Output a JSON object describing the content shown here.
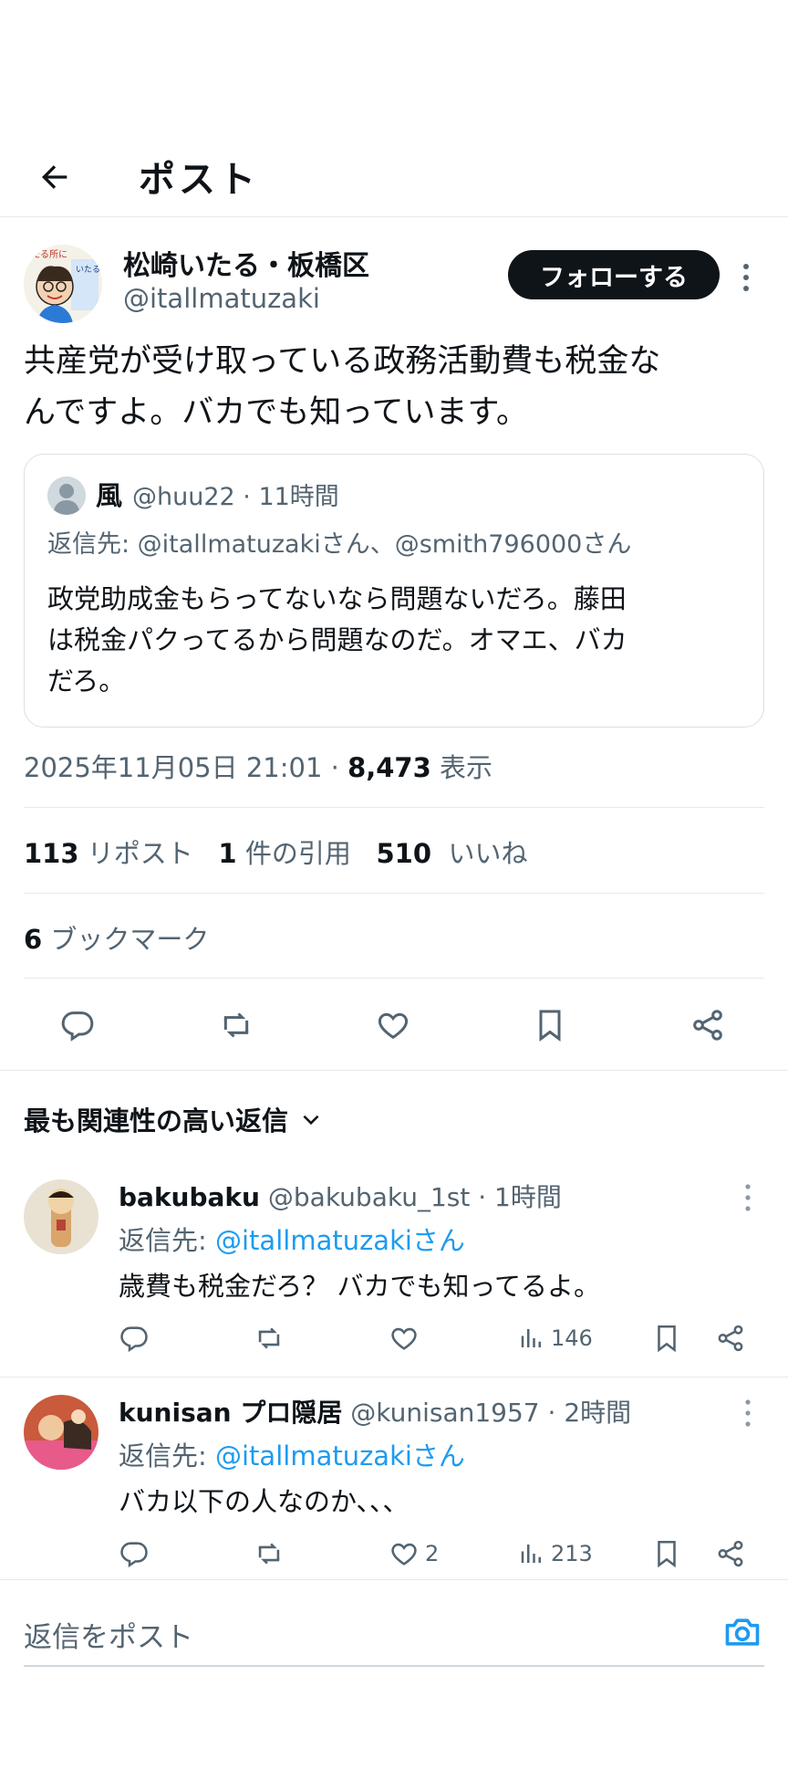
{
  "header": {
    "title": "ポスト"
  },
  "post": {
    "author_name": "松崎いたる・板橋区",
    "author_handle": "@itallmatuzaki",
    "follow_label": "フォローする",
    "text_line1": "共産党が受け取っている政務活動費も税金な",
    "text_line2": "んですよ。バカでも知っています。",
    "avatar_text_top": "たる所に",
    "avatar_text_side": "いたる"
  },
  "quote": {
    "name": "風",
    "handle_time": "@huu22 · 11時間",
    "reply_to": "返信先: @itallmatuzakiさん、@smith796000さん",
    "text_line1": "政党助成金もらってないなら問題ないだろ。藤田",
    "text_line2": "は税金パクってるから問題なのだ。オマエ、バカ",
    "text_line3": "だろ。"
  },
  "meta": {
    "date": "2025年11月05日 21:01 · ",
    "views": "8,473",
    "views_label": " 表示"
  },
  "stats": {
    "reposts": "113",
    "reposts_label": " リポスト",
    "quotes": "1",
    "quotes_label": " 件の引用",
    "likes": "510",
    "likes_label": " いいね",
    "bookmarks": "6",
    "bookmarks_label": " ブックマーク"
  },
  "sort": {
    "label": "最も関連性の高い返信"
  },
  "replies": [
    {
      "name": "bakubaku",
      "handle_time": " @bakubaku_1st · 1時間",
      "reply_to_prefix": "返信先: ",
      "reply_to_user": "@itallmatuzakiさん",
      "text": "歳費も税金だろ？ バカでも知ってるよ。",
      "likes": "",
      "views": "146"
    },
    {
      "name": "kunisan プロ隠居",
      "handle_time": " @kunisan1957 · 2時間",
      "reply_to_prefix": "返信先: ",
      "reply_to_user": "@itallmatuzakiさん",
      "text": "バカ以下の人なのか、、、",
      "likes": "2",
      "views": "213"
    }
  ],
  "compose": {
    "placeholder": "返信をポスト"
  },
  "colors": {
    "text": "#0f1419",
    "secondary": "#536471",
    "link": "#1d9bf0",
    "divider": "#e6e9ec"
  }
}
